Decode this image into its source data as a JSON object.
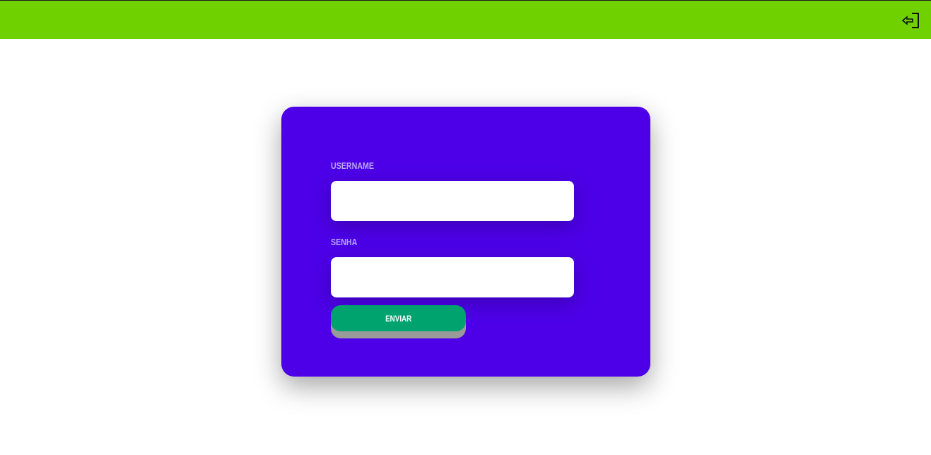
{
  "topbar": {
    "color": "#6fd200",
    "logout_icon": "logout-icon"
  },
  "login_form": {
    "card_color": "#4d00e8",
    "username": {
      "label": "USERNAME",
      "value": "",
      "placeholder": ""
    },
    "password": {
      "label": "SENHA",
      "value": "",
      "placeholder": ""
    },
    "submit": {
      "label": "ENVIAR",
      "color": "#00a36e"
    }
  }
}
